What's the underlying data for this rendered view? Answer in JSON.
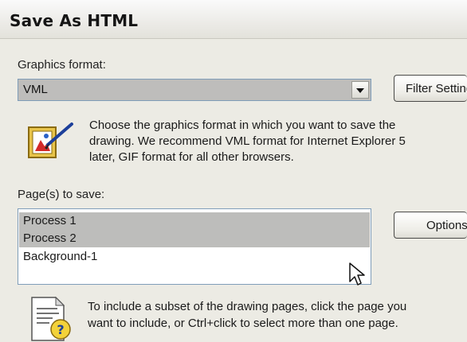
{
  "dialog": {
    "title": "Save As HTML"
  },
  "graphics": {
    "label": "Graphics format:",
    "selected": "VML",
    "filter_button": "Filter Settings",
    "description_lines": [
      "Choose the graphics format in which you want to save the",
      "drawing.  We recommend VML format for Internet Explorer 5",
      "later, GIF format for all other browsers."
    ],
    "icon": "picture-frame-edit-icon"
  },
  "pages": {
    "label": "Page(s) to save:",
    "items": [
      {
        "label": "Process 1",
        "selected": true
      },
      {
        "label": "Process 2",
        "selected": true
      },
      {
        "label": "Background-1",
        "selected": false
      }
    ],
    "options_button": "Options",
    "hint_lines": [
      "To include a subset of the drawing pages, click the page you",
      "want to include, or Ctrl+click to select more than one page."
    ],
    "icon": "document-help-icon"
  },
  "colors": {
    "selection": "#bdbdbb",
    "border": "#7f9db9",
    "dialog_bg": "#ecebe4"
  }
}
